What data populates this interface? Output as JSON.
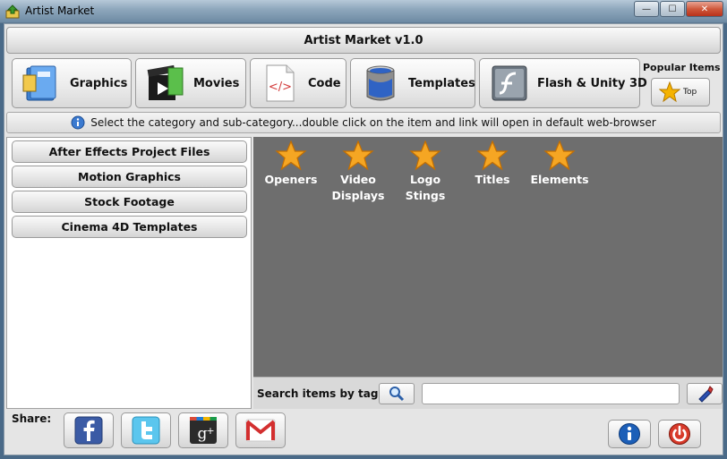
{
  "window": {
    "title": "Artist Market",
    "minimize_glyph": "—",
    "maximize_glyph": "☐",
    "close_glyph": "✕"
  },
  "header": {
    "title": "Artist Market v1.0"
  },
  "categories": [
    {
      "label": "Graphics",
      "icon": "graphics-book-icon"
    },
    {
      "label": "Movies",
      "icon": "film-clapper-icon"
    },
    {
      "label": "Code",
      "icon": "code-tag-icon"
    },
    {
      "label": "Templates",
      "icon": "paint-bucket-icon"
    },
    {
      "label": "Flash & Unity 3D",
      "icon": "flash-icon"
    }
  ],
  "popular": {
    "label": "Popular Items",
    "top_label": "Top"
  },
  "hint": {
    "text": "Select the category and sub-category...double click on the item and link will open in default web-browser"
  },
  "subcategories": [
    "After Effects Project Files",
    "Motion Graphics",
    "Stock Footage",
    "Cinema 4D Templates"
  ],
  "items": [
    {
      "label_1": "Openers",
      "label_2": ""
    },
    {
      "label_1": "Video",
      "label_2": "Displays"
    },
    {
      "label_1": "Logo",
      "label_2": "Stings"
    },
    {
      "label_1": "Titles",
      "label_2": ""
    },
    {
      "label_1": "Elements",
      "label_2": ""
    }
  ],
  "search": {
    "label": "Search items by tags",
    "value": ""
  },
  "share": {
    "label": "Share:"
  },
  "colors": {
    "item_panel": "#6e6e6e",
    "star": "#f5a623",
    "accent": "#1c5fb8"
  }
}
